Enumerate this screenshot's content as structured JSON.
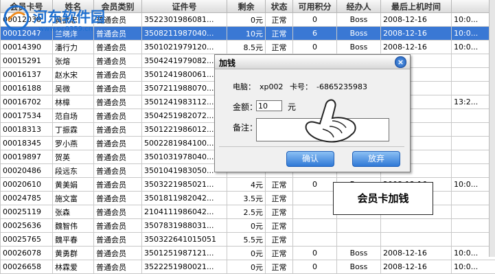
{
  "watermark": {
    "site": "河东软件园",
    "url": "www.pc0359.cn"
  },
  "columns": [
    "会员卡号",
    "姓名",
    "会员类别",
    "证件号",
    "剩余",
    "状态",
    "可用积分",
    "经办人",
    "最后上机时间",
    ""
  ],
  "rows": [
    [
      "00012038",
      "黄武忠",
      "普通会员",
      "3522301986081...",
      "0元",
      "正常",
      "0",
      "Boss",
      "2008-12-16",
      "10:0..."
    ],
    [
      "00012047",
      "兰晓洋",
      "普通会员",
      "3508211987040...",
      "10元",
      "正常",
      "6",
      "Boss",
      "2008-12-16",
      "10:0..."
    ],
    [
      "00014390",
      "潘行力",
      "普通会员",
      "3501021979120...",
      "8.5元",
      "正常",
      "0",
      "Boss",
      "2008-12-16",
      "10:0..."
    ],
    [
      "00015291",
      "张熔",
      "普通会员",
      "3504241979082...",
      "",
      "",
      "",
      "",
      "",
      ""
    ],
    [
      "00016137",
      "赵水宋",
      "普通会员",
      "3501241980061...",
      "",
      "",
      "",
      "",
      "",
      ""
    ],
    [
      "00016188",
      "吴微",
      "普通会员",
      "3507211988070...",
      "",
      "",
      "",
      "",
      "",
      ""
    ],
    [
      "00016702",
      "林樟",
      "普通会员",
      "3501241983112...",
      "",
      "",
      "",
      "",
      "2-22",
      "13:2..."
    ],
    [
      "00017534",
      "范自场",
      "普通会员",
      "3504251982072...",
      "",
      "",
      "",
      "",
      "",
      ""
    ],
    [
      "00018313",
      "丁振霖",
      "普通会员",
      "3501221986012...",
      "",
      "",
      "",
      "",
      "",
      ""
    ],
    [
      "00018345",
      "罗小燕",
      "普通会员",
      "5002281984100...",
      "",
      "",
      "",
      "",
      "",
      ""
    ],
    [
      "00019897",
      "贺英",
      "普通会员",
      "3501031978040...",
      "",
      "",
      "",
      "",
      "",
      ""
    ],
    [
      "00020486",
      "段远东",
      "普通会员",
      "3501041983050...",
      "",
      "",
      "",
      "",
      "",
      ""
    ],
    [
      "00020610",
      "黄美娟",
      "普通会员",
      "3503221985021...",
      "4元",
      "正常",
      "0",
      "Boss",
      "2008-12-16",
      "10:0..."
    ],
    [
      "00024785",
      "施文富",
      "普通会员",
      "3501811982042...",
      "3.5元",
      "正常",
      "",
      "",
      "",
      ""
    ],
    [
      "00025119",
      "张森",
      "普通会员",
      "2104111986042...",
      "2.5元",
      "正常",
      "",
      "",
      "",
      ""
    ],
    [
      "00025636",
      "魏智伟",
      "普通会员",
      "3507831988031...",
      "0元",
      "正常",
      "",
      "",
      "",
      ""
    ],
    [
      "00025765",
      "魏平春",
      "普通会员",
      "350322641015051",
      "5.5元",
      "正常",
      "",
      "",
      "",
      ""
    ],
    [
      "00026078",
      "黄勇群",
      "普通会员",
      "3501251987121...",
      "0元",
      "正常",
      "0",
      "Boss",
      "2008-12-16",
      "10:0..."
    ],
    [
      "00026658",
      "林霖爱",
      "普通会员",
      "3522251980021...",
      "0元",
      "正常",
      "0",
      "Boss",
      "2008-12-16",
      "10:0..."
    ]
  ],
  "selected_row": 1,
  "dialog": {
    "title": "加钱",
    "close": "×",
    "computer_label": "电脑：",
    "computer_value": "xp002",
    "card_label": "卡号：",
    "card_value": "-6865235983",
    "amount_label": "金额：",
    "amount_value": "10",
    "amount_unit": "元",
    "remark_label": "备注：",
    "remark_value": "",
    "ok": "确认",
    "cancel": "放弃"
  },
  "caption": "会员卡加钱",
  "colors": {
    "selected_row": "#3a78d4",
    "button": "#2f78d6",
    "logo_blue": "#1e6fd0"
  }
}
